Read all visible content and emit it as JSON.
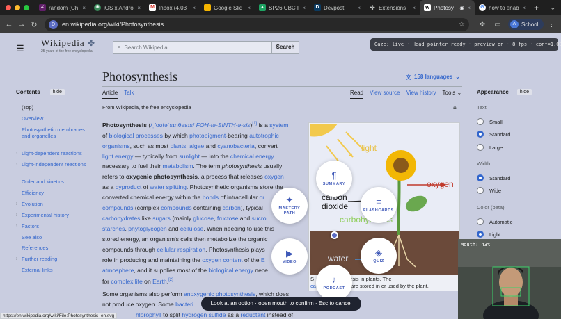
{
  "browser": {
    "tabs": [
      {
        "label": "random (Ch",
        "icon": "slack-icon"
      },
      {
        "label": "iOS x Andro",
        "icon": "chatgpt-icon"
      },
      {
        "label": "Inbox (4,03",
        "icon": "gmail-icon"
      },
      {
        "label": "Google Slid",
        "icon": "slides-icon"
      },
      {
        "label": "SP26 CBC F",
        "icon": "drive-icon"
      },
      {
        "label": "Devpost",
        "icon": "devpost-icon"
      },
      {
        "label": "Extensions",
        "icon": "puzzle-icon"
      },
      {
        "label": "Photosy",
        "icon": "wikipedia-icon",
        "active": true
      },
      {
        "label": "how to enab",
        "icon": "google-icon"
      }
    ],
    "url": "en.wikipedia.org/wiki/Photosynthesis",
    "profile_label": "School",
    "profile_initial": "A"
  },
  "wiki": {
    "logo_word": "Wikipedia",
    "logo_tagline": "25 years of the free encyclopedia",
    "search_placeholder": "Search Wikipedia",
    "search_button": "Search",
    "title": "Photosynthesis",
    "languages": "158 languages",
    "tabs_left": [
      "Article",
      "Talk"
    ],
    "tabs_right": [
      "Read",
      "View source",
      "View history",
      "Tools"
    ],
    "from": "From Wikipedia, the free encyclopedia"
  },
  "gaze_status": "Gaze: live · Head pointer ready · preview on · 8 fps · conf=1.00",
  "toc": {
    "heading": "Contents",
    "hide": "hide",
    "items": [
      {
        "label": "(Top)",
        "expandable": false
      },
      {
        "label": "Overview",
        "expandable": false
      },
      {
        "label": "Photosynthetic membranes and organelles",
        "expandable": false
      },
      {
        "label": "Light-dependent reactions",
        "expandable": true
      },
      {
        "label": "Light-independent reactions",
        "expandable": true
      },
      {
        "label": "Order and kinetics",
        "expandable": false
      },
      {
        "label": "Efficiency",
        "expandable": false
      },
      {
        "label": "Evolution",
        "expandable": true
      },
      {
        "label": "Experimental history",
        "expandable": true
      },
      {
        "label": "Factors",
        "expandable": true
      },
      {
        "label": "See also",
        "expandable": false
      },
      {
        "label": "References",
        "expandable": false
      },
      {
        "label": "Further reading",
        "expandable": true
      },
      {
        "label": "External links",
        "expandable": false
      }
    ]
  },
  "article": {
    "l1": [
      "Photosynthesis",
      " (",
      "/ˌfoʊtəˈsɪnθəsɪs/",
      " ",
      "FOH-tə-SINTH-ə-sis",
      ")",
      "[1]",
      " is a ",
      "system"
    ],
    "l2": [
      "of ",
      "biological processes",
      " by which ",
      "photopigment",
      "-bearing ",
      "autotrophic"
    ],
    "l3": [
      "organisms",
      ", such as most ",
      "plants",
      ", ",
      "algae",
      " and ",
      "cyanobacteria",
      ", convert"
    ],
    "l4": [
      "light energy",
      " — typically from ",
      "sunlight",
      " — into the ",
      "chemical energy"
    ],
    "l5": [
      "necessary to fuel their ",
      "metabolism",
      ". The term ",
      "photosynthesis",
      " usually"
    ],
    "l6": [
      "refers to ",
      "oxygenic photosynthesis",
      ", a process that releases ",
      "oxygen"
    ],
    "l7": [
      "as a ",
      "byproduct",
      " of ",
      "water splitting",
      ". Photosynthetic organisms store the"
    ],
    "l8": [
      "converted chemical energy within the ",
      "bonds",
      " of intracellular ",
      "or"
    ],
    "l9": [
      "compounds",
      " (complex ",
      "compounds",
      " containing ",
      "carbon",
      "), typical"
    ],
    "l10": [
      "carbohydrates",
      " like ",
      "sugars",
      " (mainly ",
      "glucose",
      ", ",
      "fructose",
      " and ",
      "sucro"
    ],
    "l11": [
      "starches",
      ", ",
      "phytoglycogen",
      " and ",
      "cellulose",
      ". When needing to use this"
    ],
    "l12": [
      "stored energy, an organism's cells then metabolize the organic"
    ],
    "l13": [
      "compounds through ",
      "cellular respiration",
      ". Photosynthesis plays"
    ],
    "l14": [
      "role in producing and maintaining the ",
      "oxygen content",
      " of the ",
      "E"
    ],
    "l15": [
      "atmosphere",
      ", and it supplies most of the ",
      "biological energy",
      " nece"
    ],
    "l16": [
      "for ",
      "complex life",
      " on ",
      "Earth",
      ".",
      "[2]"
    ],
    "p2l1": [
      "Some organisms also perform ",
      "anoxygenic photosynthesis",
      ", which does"
    ],
    "p2l2": [
      "not produce oxygen. Some ",
      "bacteri"
    ],
    "p2l3": [
      "hlorophyll",
      " to split ",
      "hydrogen sulfide",
      " as a ",
      "reductant",
      " instead of"
    ]
  },
  "infobox": {
    "labels": {
      "light": "light",
      "oxygen": "oxygen",
      "carbon": "carbon",
      "dioxide": "dioxide",
      "carbohydrates": "carbohydrates",
      "water": "water"
    },
    "caption_a": "S",
    "caption_b": "tosynthesis in plants. The",
    "caption_c": "ca",
    "caption_d": "roduced are stored in or used by the plant."
  },
  "appearance": {
    "heading": "Appearance",
    "hide": "hide",
    "text_label": "Text",
    "text_options": [
      {
        "label": "Small",
        "on": false
      },
      {
        "label": "Standard",
        "on": true
      },
      {
        "label": "Large",
        "on": false
      }
    ],
    "width_label": "Width",
    "width_options": [
      {
        "label": "Standard",
        "on": true
      },
      {
        "label": "Wide",
        "on": false
      }
    ],
    "color_label": "Color (beta)",
    "color_options": [
      {
        "label": "Automatic",
        "on": false
      },
      {
        "label": "Light",
        "on": true
      }
    ]
  },
  "gaze_menu": {
    "summary": "SUMMARY",
    "mastery": "MASTERY PATH",
    "flashcards": "FLASHCARDS",
    "video": "VIDEO",
    "quiz": "QUIZ",
    "podcast": "PODCAST"
  },
  "hint": "Look at an option · open mouth to confirm · Esc to cancel",
  "cam_mouth": "Mouth: 43%",
  "status_url": "https://en.wikipedia.org/wiki/File:Photosynthesis_en.svg",
  "colors": {
    "link": "#3366cc",
    "gaze_accent": "#3f59b8",
    "overlay_tint": "#c9cde0"
  }
}
